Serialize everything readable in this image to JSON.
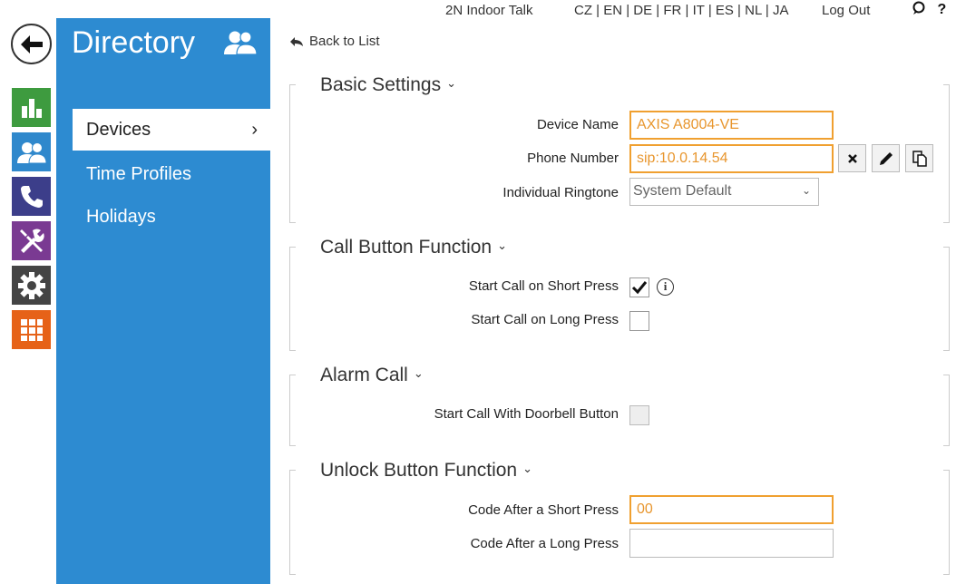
{
  "topbar": {
    "product": "2N Indoor Talk",
    "languages": "CZ | EN | DE | FR | IT | ES | NL | JA",
    "logout": "Log Out",
    "help_icon": "?"
  },
  "back_link": "Back to List",
  "rail": {
    "items": [
      "back-arrow-icon",
      "status-icon",
      "directory-icon",
      "services-icon",
      "hardware-icon",
      "system-icon",
      "apps-icon"
    ]
  },
  "sidebar": {
    "title": "Directory",
    "items": [
      {
        "label": "Devices",
        "active": true
      },
      {
        "label": "Time Profiles"
      },
      {
        "label": "Holidays"
      }
    ]
  },
  "sections": {
    "basic": {
      "title": "Basic Settings",
      "device_name_label": "Device Name",
      "device_name_value": "AXIS A8004-VE",
      "phone_label": "Phone Number",
      "phone_value": "sip:10.0.14.54",
      "ringtone_label": "Individual Ringtone",
      "ringtone_value": "System Default"
    },
    "call_button": {
      "title": "Call Button Function",
      "short_label": "Start Call on Short Press",
      "short_checked": true,
      "long_label": "Start Call on Long Press",
      "long_checked": false,
      "info_glyph": "i"
    },
    "alarm": {
      "title": "Alarm Call",
      "doorbell_label": "Start Call With Doorbell Button",
      "doorbell_checked": false
    },
    "unlock": {
      "title": "Unlock Button Function",
      "short_code_label": "Code After a Short Press",
      "short_code_value": "00",
      "long_code_label": "Code After a Long Press",
      "long_code_value": ""
    }
  },
  "colors": {
    "sidebar_blue": "#2d8bd1",
    "accent_orange": "#f0a030",
    "status_green": "#3e9b3f",
    "apps_orange": "#e66218"
  }
}
